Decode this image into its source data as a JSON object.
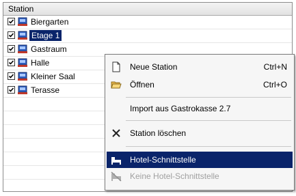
{
  "list": {
    "column_header": "Station",
    "rows": [
      {
        "label": "Biergarten",
        "checked": true,
        "selected": false
      },
      {
        "label": "Etage 1",
        "checked": true,
        "selected": true
      },
      {
        "label": "Gastraum",
        "checked": true,
        "selected": false
      },
      {
        "label": "Halle",
        "checked": true,
        "selected": false
      },
      {
        "label": "Kleiner Saal",
        "checked": true,
        "selected": false
      },
      {
        "label": "Terasse",
        "checked": true,
        "selected": false
      }
    ],
    "icon": "station-icon"
  },
  "context_menu": {
    "items": [
      {
        "label": "Neue Station",
        "shortcut": "Ctrl+N",
        "icon": "new-document-icon"
      },
      {
        "label": "Öffnen",
        "shortcut": "Ctrl+O",
        "icon": "open-folder-icon"
      },
      {
        "label": "Import aus Gastrokasse 2.7",
        "shortcut": "",
        "icon": ""
      },
      {
        "label": "Station löschen",
        "shortcut": "",
        "icon": "delete-x-icon"
      },
      {
        "label": "Hotel-Schnittstelle",
        "shortcut": "",
        "icon": "hotel-bed-icon",
        "highlighted": true
      },
      {
        "label": "Keine Hotel-Schnittstelle",
        "shortcut": "",
        "icon": "no-hotel-bed-icon",
        "disabled": true
      }
    ]
  },
  "colors": {
    "selection": "#0a246a",
    "disabled_text": "#a0a0a0",
    "menu_background": "#f6f6f6"
  }
}
